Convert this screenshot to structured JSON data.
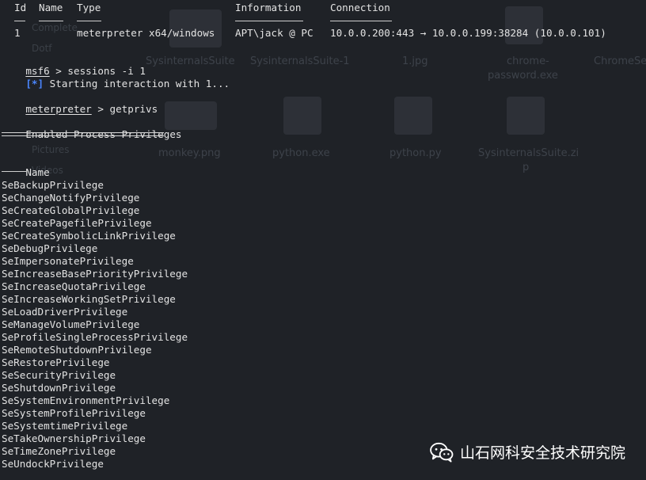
{
  "sessions_table": {
    "headers": {
      "id": "Id",
      "name": "Name",
      "type": "Type",
      "information": "Information",
      "connection": "Connection"
    },
    "row": {
      "id": "1",
      "name": "",
      "type": "meterpreter x64/windows",
      "information": "APT\\jack @ PC",
      "connection": "10.0.0.200:443 → 10.0.0.199:38284 (10.0.0.101)"
    }
  },
  "command1": {
    "prompt": "msf6",
    "text": " > sessions -i 1"
  },
  "status": {
    "marker": "[*]",
    "text": " Starting interaction with 1..."
  },
  "command2": {
    "prompt": "meterpreter",
    "text": " > getprivs"
  },
  "privileges": {
    "heading": "Enabled Process Privileges",
    "column_header": "Name",
    "items": [
      "SeBackupPrivilege",
      "SeChangeNotifyPrivilege",
      "SeCreateGlobalPrivilege",
      "SeCreatePagefilePrivilege",
      "SeCreateSymbolicLinkPrivilege",
      "SeDebugPrivilege",
      "SeImpersonatePrivilege",
      "SeIncreaseBasePriorityPrivilege",
      "SeIncreaseQuotaPrivilege",
      "SeIncreaseWorkingSetPrivilege",
      "SeLoadDriverPrivilege",
      "SeManageVolumePrivilege",
      "SeProfileSingleProcessPrivilege",
      "SeRemoteShutdownPrivilege",
      "SeRestorePrivilege",
      "SeSecurityPrivilege",
      "SeShutdownPrivilege",
      "SeSystemEnvironmentPrivilege",
      "SeSystemProfilePrivilege",
      "SeSystemtimePrivilege",
      "SeTakeOwnershipPrivilege",
      "SeTimeZonePrivilege",
      "SeUndockPrivilege"
    ]
  },
  "desktop_ghost": {
    "labels": [
      "SysinternalsSuite",
      "SysinternalsSuite-1",
      "1.jpg",
      "chrome-",
      "password.exe",
      "ChromeSetup",
      "monkey.png",
      "python.exe",
      "python.py",
      "SysinternalsSuite.zi",
      "p"
    ],
    "sidebar": [
      "Complete",
      "Dotf",
      "Pictures",
      "Videos"
    ]
  },
  "watermark": {
    "text": "山石网科安全技术研究院",
    "icon": "wechat-icon"
  },
  "colors": {
    "background": "#1f2227",
    "text": "#e3e3e3",
    "prompt_blue": "#4a86ff",
    "watermark": "#ffffff"
  }
}
